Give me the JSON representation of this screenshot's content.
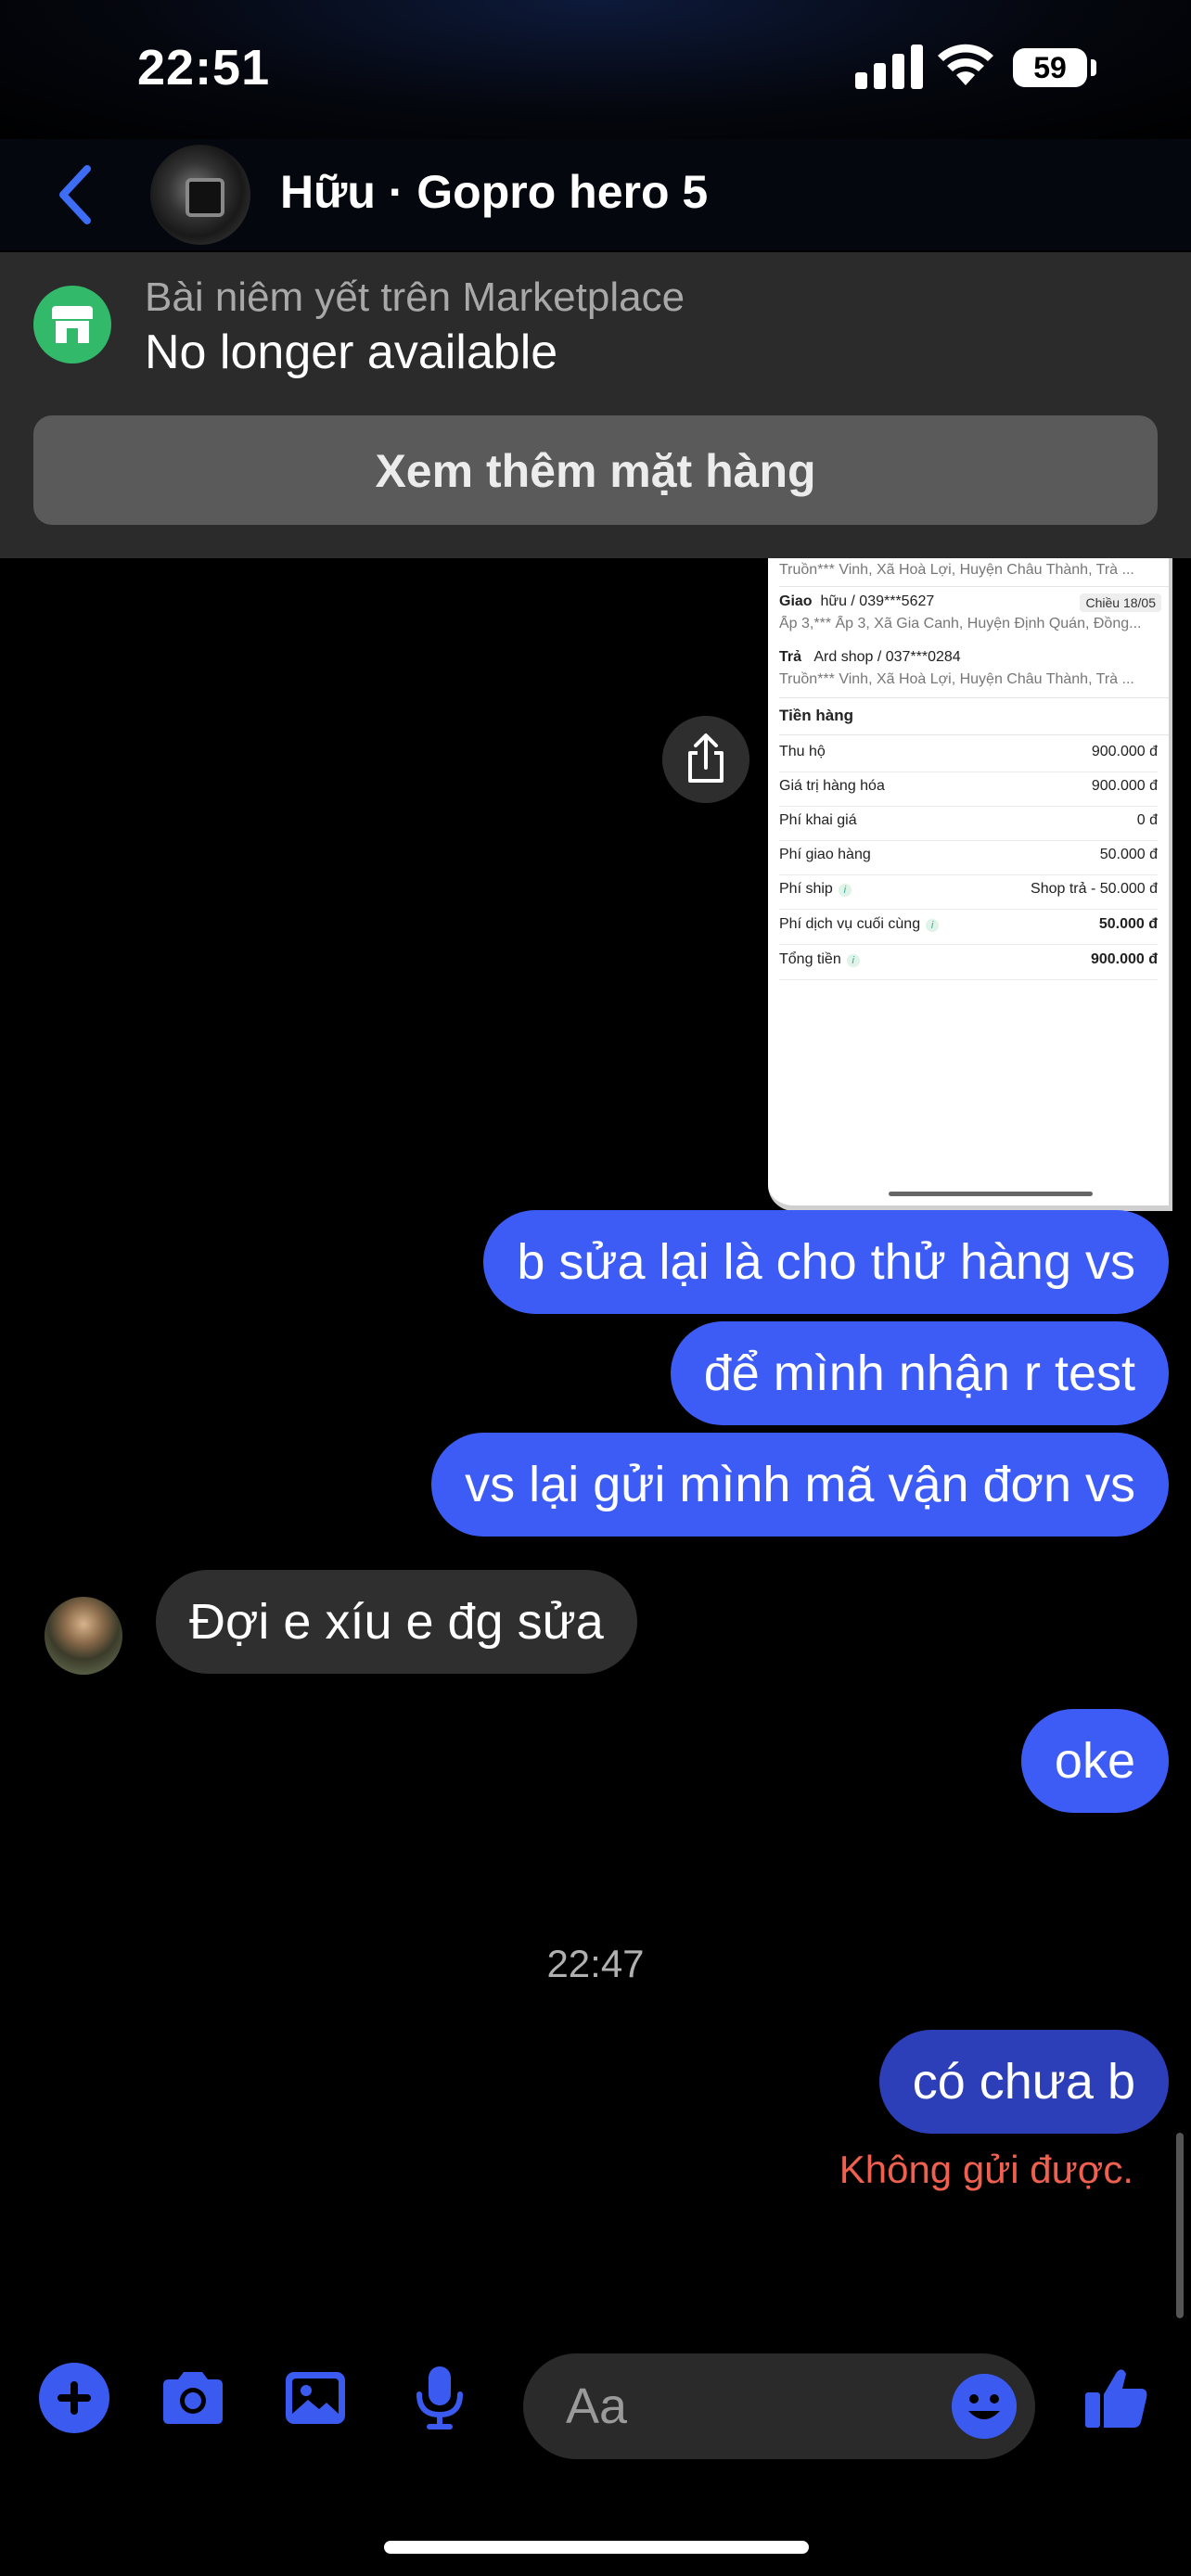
{
  "status_bar": {
    "time": "22:51",
    "battery": "59"
  },
  "header": {
    "title": "Hữu · Gopro hero 5"
  },
  "marketplace": {
    "label": "Bài niêm yết trên Marketplace",
    "status": "No longer available",
    "button": "Xem thêm mặt hàng"
  },
  "receipt": {
    "address_top": "Truồn*** Vinh, Xã Hoà Lợi, Huyện Châu Thành, Trà ...",
    "giao_label": "Giao",
    "giao_contact": "hữu / 039***5627",
    "giao_badge": "Chiều 18/05",
    "giao_address": "Ấp 3,*** Ấp 3, Xã Gia Canh, Huyện Định Quán, Đồng...",
    "tra_label": "Trả",
    "tra_contact": "Ard shop / 037***0284",
    "tra_address": "Truồn*** Vinh, Xã Hoà Lợi, Huyện Châu Thành, Trà ...",
    "section": "Tiền hàng",
    "fees": [
      {
        "label": "Thu hộ",
        "value": "900.000 đ"
      },
      {
        "label": "Giá trị hàng hóa",
        "value": "900.000 đ"
      },
      {
        "label": "Phí khai giá",
        "value": "0 đ"
      },
      {
        "label": "Phí giao hàng",
        "value": "50.000 đ"
      },
      {
        "label": "Phí ship",
        "value": "Shop trả - 50.000 đ"
      },
      {
        "label": "Phí dịch vụ cuối cùng",
        "value": "50.000 đ"
      },
      {
        "label": "Tổng tiền",
        "value": "900.000 đ"
      }
    ]
  },
  "messages": {
    "m1": "b sửa lại là cho thử hàng vs",
    "m2": "để mình nhận r test",
    "m3": "vs lại gửi mình mã vận đơn vs",
    "m4": "Đợi e xíu e đg sửa",
    "m5": "oke",
    "timestamp": "22:47",
    "m6": "có chưa b",
    "failed": "Không gửi được."
  },
  "composer": {
    "placeholder": "Aa"
  },
  "icons": [
    "back-chevron-icon",
    "marketplace-store-icon",
    "share-icon",
    "plus-icon",
    "camera-icon",
    "image-icon",
    "microphone-icon",
    "emoji-icon",
    "thumbs-up-icon"
  ],
  "colors": {
    "accent": "#3d5cf5",
    "error": "#f0604f",
    "marketplace_green": "#33b96a"
  }
}
